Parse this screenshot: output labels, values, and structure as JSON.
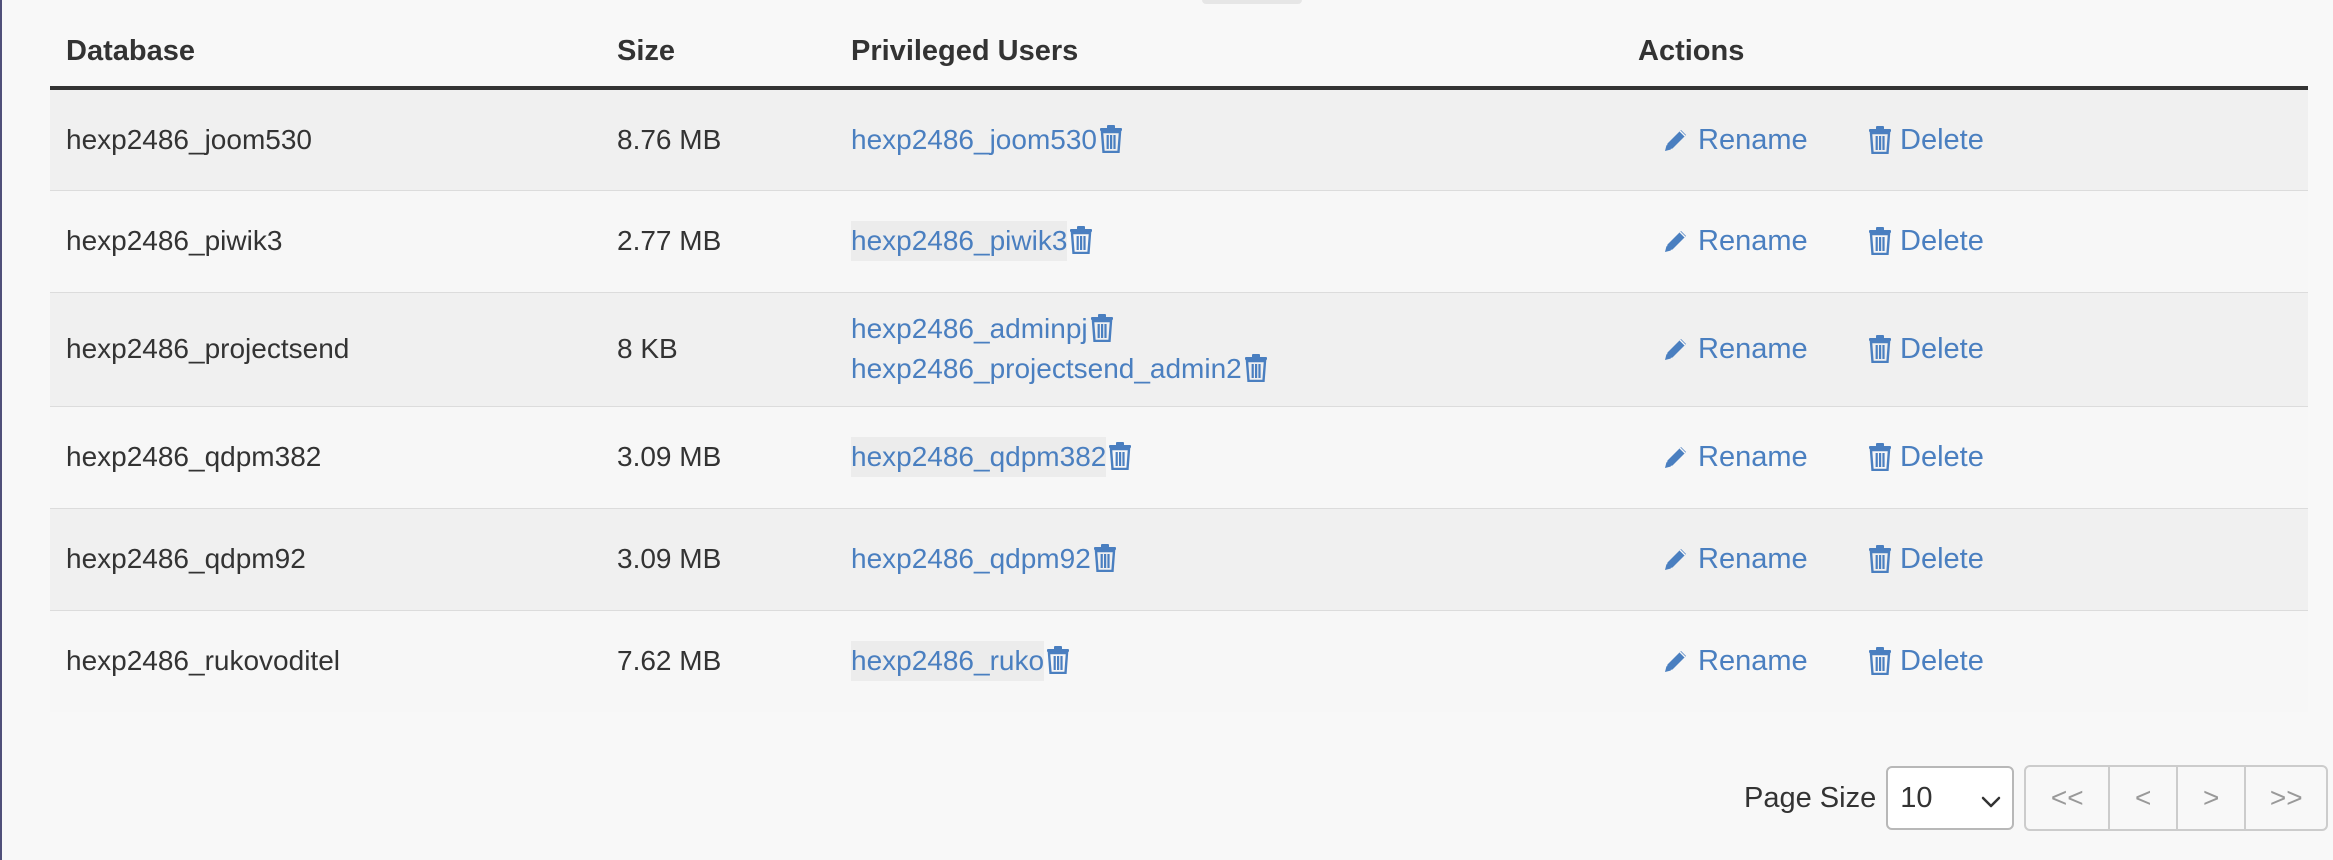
{
  "table": {
    "headers": {
      "database": "Database",
      "size": "Size",
      "users": "Privileged Users",
      "actions": "Actions"
    },
    "rows": [
      {
        "database": "hexp2486_joom530",
        "size": "8.76 MB",
        "users": [
          "hexp2486_joom530"
        ]
      },
      {
        "database": "hexp2486_piwik3",
        "size": "2.77 MB",
        "users": [
          "hexp2486_piwik3"
        ]
      },
      {
        "database": "hexp2486_projectsend",
        "size": "8 KB",
        "users": [
          "hexp2486_adminpj",
          "hexp2486_projectsend_admin2"
        ]
      },
      {
        "database": "hexp2486_qdpm382",
        "size": "3.09 MB",
        "users": [
          "hexp2486_qdpm382"
        ]
      },
      {
        "database": "hexp2486_qdpm92",
        "size": "3.09 MB",
        "users": [
          "hexp2486_qdpm92"
        ]
      },
      {
        "database": "hexp2486_rukovoditel",
        "size": "7.62 MB",
        "users": [
          "hexp2486_ruko"
        ]
      }
    ],
    "rename_label": "Rename",
    "delete_label": "Delete"
  },
  "pagination": {
    "page_size_label": "Page Size",
    "page_size_value": "10",
    "first_label": "<<",
    "prev_label": "<",
    "next_label": ">",
    "last_label": ">>"
  },
  "icons": {
    "user_remove": "trash-icon",
    "rename": "pencil-icon",
    "delete": "trash-icon",
    "select": "chevron-down-icon"
  },
  "colors": {
    "link": "#4a7fc0",
    "text": "#333333",
    "row_odd": "#f0f0f0",
    "row_even": "#f7f7f7",
    "pager_disabled": "#999999"
  }
}
